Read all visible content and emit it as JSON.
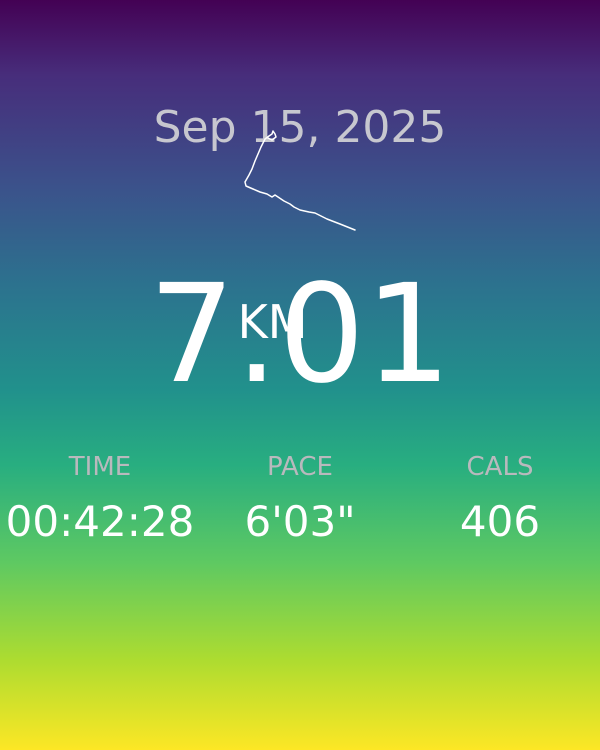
{
  "workout": {
    "date": "Sep 15, 2025",
    "distance": "7.01",
    "distance_unit": "KM"
  },
  "stats": {
    "time": {
      "label": "TIME",
      "value": "00:42:28"
    },
    "pace": {
      "label": "PACE",
      "value": "6'03\""
    },
    "calories": {
      "label": "CALS",
      "value": "406"
    }
  },
  "colors": {
    "gradient_top": "#440154",
    "gradient_bottom": "#fde725",
    "text_primary": "#ffffff",
    "text_secondary": "#b9b9bd"
  }
}
